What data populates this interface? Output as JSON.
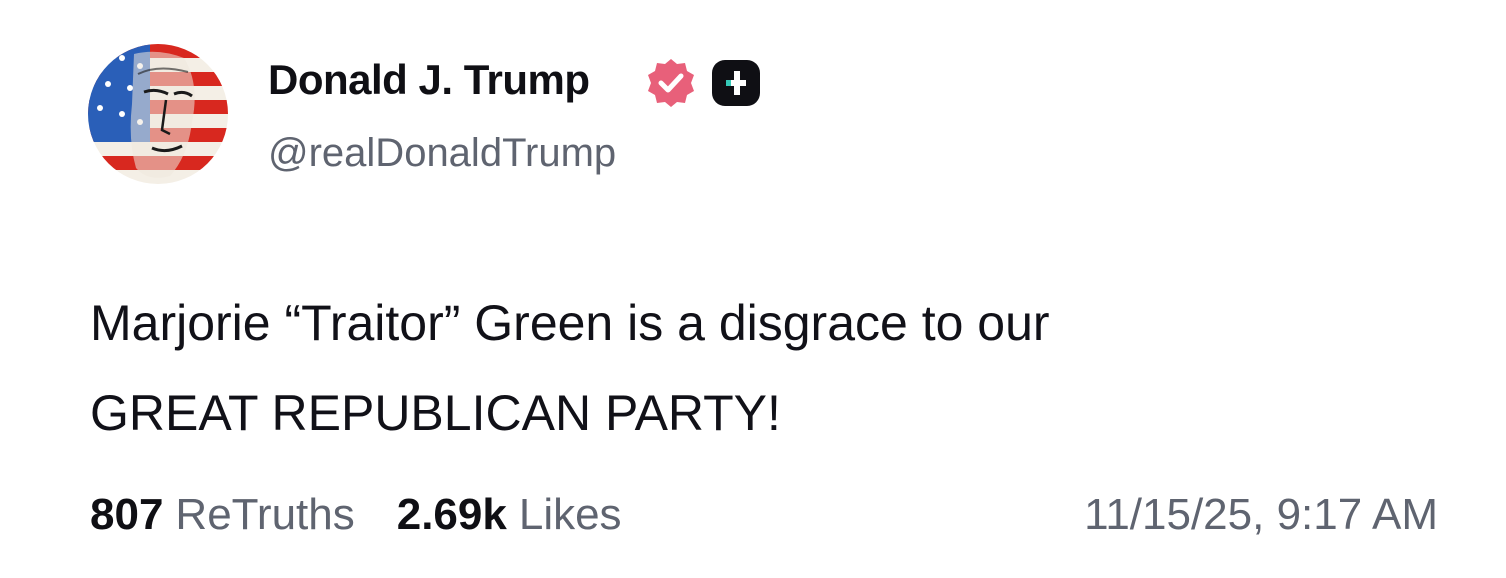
{
  "author": {
    "display_name": "Donald J. Trump",
    "handle": "@realDonaldTrump",
    "avatar": "flag-portrait-avatar",
    "verified_icon": "verified-badge-icon",
    "verified_color": "#e8607a",
    "extra_badge_icon": "plus-badge-icon"
  },
  "post": {
    "text_lines": [
      "Marjorie “Traitor” Green is a disgrace to our",
      "GREAT REPUBLICAN PARTY!"
    ]
  },
  "stats": {
    "retruths_count": "807",
    "retruths_label": "ReTruths",
    "likes_count": "2.69k",
    "likes_label": "Likes"
  },
  "timestamp": "11/15/25, 9:17 AM"
}
